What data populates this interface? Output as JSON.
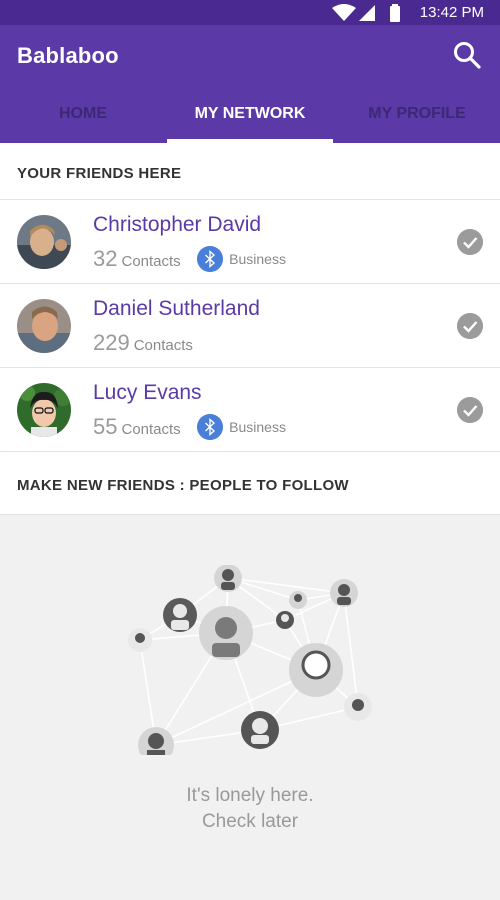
{
  "status": {
    "time": "13:42 PM"
  },
  "app": {
    "title": "Bablaboo"
  },
  "tabs": [
    {
      "label": "HOME"
    },
    {
      "label": "MY NETWORK"
    },
    {
      "label": "MY PROFILE"
    }
  ],
  "friends_section": {
    "title": "YOUR FRIENDS HERE"
  },
  "friends": [
    {
      "name": "Christopher David",
      "count": "32",
      "count_label": "Contacts",
      "badge": "Business"
    },
    {
      "name": "Daniel Sutherland",
      "count": "229",
      "count_label": "Contacts"
    },
    {
      "name": "Lucy Evans",
      "count": "55",
      "count_label": "Contacts",
      "badge": "Business"
    }
  ],
  "follow_section": {
    "title": "MAKE NEW FRIENDS : PEOPLE TO FOLLOW"
  },
  "empty_state": {
    "line1": "It's lonely here.",
    "line2": "Check later"
  },
  "colors": {
    "primary": "#5b3aa7",
    "status_bar": "#4a2a91",
    "accent_bluetooth": "#4a7fd9"
  }
}
